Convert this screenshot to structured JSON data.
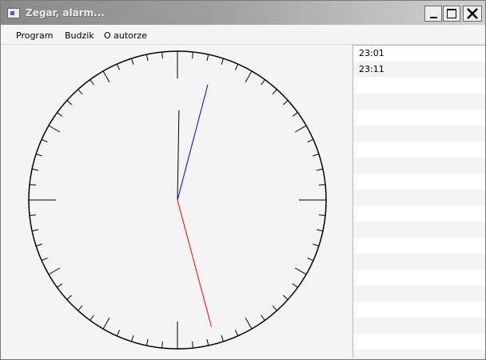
{
  "window": {
    "title": "Zegar, alarm...",
    "icon": "app-window-icon",
    "controls": [
      "minimize-icon",
      "maximize-icon",
      "close-icon"
    ]
  },
  "menu": {
    "items": [
      "Program",
      "Budzik",
      "O autorze"
    ]
  },
  "clock": {
    "time": {
      "hours": 0,
      "minutes": 2,
      "seconds": 27.5
    },
    "colors": {
      "face": "#000000",
      "hour_hand": "#000000",
      "minute_hand": "#0000ff",
      "second_hand": "#ff0000"
    }
  },
  "alarms": {
    "items": [
      "23:01",
      "23:11"
    ]
  }
}
